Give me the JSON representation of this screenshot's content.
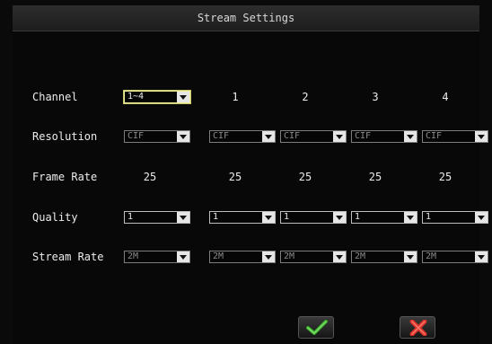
{
  "window": {
    "title": "Stream Settings"
  },
  "labels": {
    "channel": "Channel",
    "resolution": "Resolution",
    "frame_rate": "Frame Rate",
    "quality": "Quality",
    "stream_rate": "Stream Rate"
  },
  "channel": {
    "selected": "1~4",
    "columns": [
      "1",
      "2",
      "3",
      "4"
    ]
  },
  "resolution": {
    "all": "CIF",
    "per_channel": [
      "CIF",
      "CIF",
      "CIF",
      "CIF"
    ]
  },
  "frame_rate": {
    "all": "25",
    "per_channel": [
      "25",
      "25",
      "25",
      "25"
    ]
  },
  "quality": {
    "all": "1",
    "per_channel": [
      "1",
      "1",
      "1",
      "1"
    ]
  },
  "stream_rate": {
    "all": "2M",
    "per_channel": [
      "2M",
      "2M",
      "2M",
      "2M"
    ]
  },
  "buttons": {
    "ok_icon": "check-icon",
    "cancel_icon": "x-icon"
  },
  "colors": {
    "background": "#080808",
    "ok": "#3aa82a",
    "cancel": "#d8322a"
  }
}
